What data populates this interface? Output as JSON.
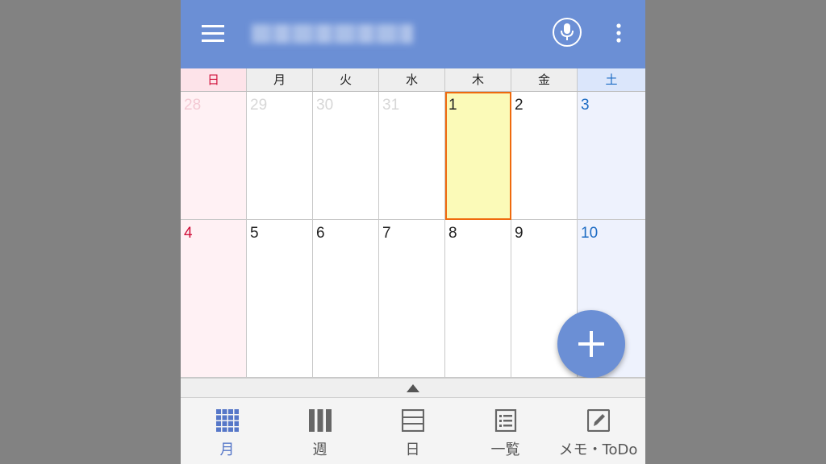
{
  "colors": {
    "appbar": "#6b8fd5",
    "sunday": "#d0103a",
    "saturday": "#1d6cc4",
    "today_border": "#ef6a0e",
    "today_fill": "#fbfab8",
    "nav_active": "#5677c8"
  },
  "appbar": {
    "menu_icon": "hamburger-menu-icon",
    "mic_icon": "microphone-icon",
    "overflow_icon": "more-vertical-icon"
  },
  "weekdays": [
    "日",
    "月",
    "火",
    "水",
    "木",
    "金",
    "土"
  ],
  "weeks": [
    [
      {
        "day": "28",
        "other_month": true
      },
      {
        "day": "29",
        "other_month": true
      },
      {
        "day": "30",
        "other_month": true
      },
      {
        "day": "31",
        "other_month": true
      },
      {
        "day": "1",
        "other_month": false,
        "today": true
      },
      {
        "day": "2",
        "other_month": false
      },
      {
        "day": "3",
        "other_month": false
      }
    ],
    [
      {
        "day": "4",
        "other_month": false
      },
      {
        "day": "5",
        "other_month": false
      },
      {
        "day": "6",
        "other_month": false
      },
      {
        "day": "7",
        "other_month": false
      },
      {
        "day": "8",
        "other_month": false
      },
      {
        "day": "9",
        "other_month": false
      },
      {
        "day": "10",
        "other_month": false
      }
    ]
  ],
  "fab": {
    "icon": "plus-icon"
  },
  "bottom_nav": [
    {
      "label": "月",
      "icon": "month-grid-icon",
      "active": true
    },
    {
      "label": "週",
      "icon": "week-columns-icon",
      "active": false
    },
    {
      "label": "日",
      "icon": "day-rows-icon",
      "active": false
    },
    {
      "label": "一覧",
      "icon": "list-icon",
      "active": false
    },
    {
      "label": "メモ・ToDo",
      "icon": "memo-pencil-icon",
      "active": false
    }
  ]
}
